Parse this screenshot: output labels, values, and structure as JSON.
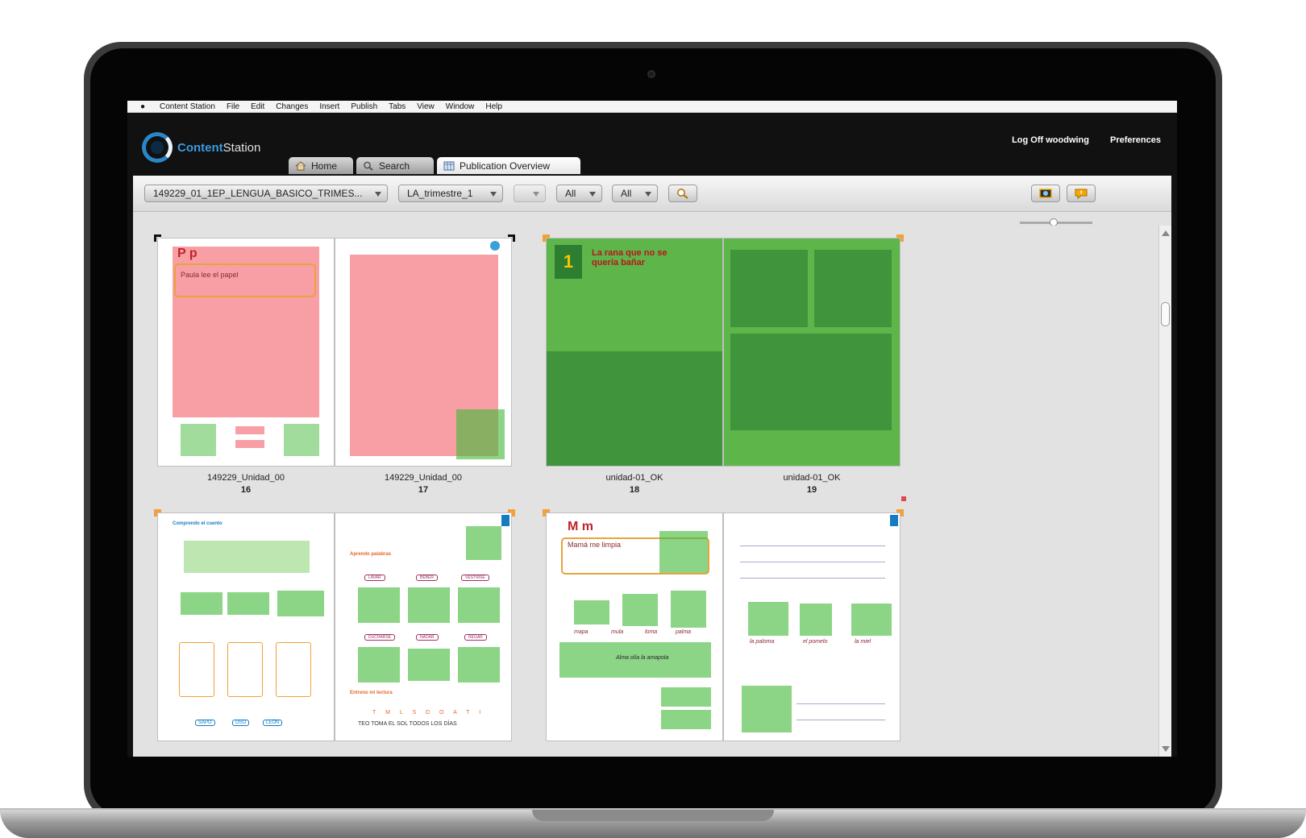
{
  "menubar": {
    "items": [
      "Content Station",
      "File",
      "Edit",
      "Changes",
      "Insert",
      "Publish",
      "Tabs",
      "View",
      "Window",
      "Help"
    ]
  },
  "app": {
    "logo_part1": "Content",
    "logo_part2": "Station",
    "tabs": [
      {
        "label": "Home",
        "icon": "home-icon"
      },
      {
        "label": "Search",
        "icon": "search-icon"
      },
      {
        "label": "Publication Overview",
        "icon": "grid-icon",
        "active": true
      }
    ],
    "logoff": "Log Off woodwing",
    "preferences": "Preferences"
  },
  "toolbar": {
    "publication": "149229_01_1EP_LENGUA_BASICO_TRIMES...",
    "issue": "LA_trimestre_1",
    "edition": "",
    "filter1": "All",
    "filter2": "All"
  },
  "spreads": [
    {
      "left_name": "149229_Unidad_00",
      "left_num": "16",
      "right_name": "149229_Unidad_00",
      "right_num": "17",
      "status": "red"
    },
    {
      "left_name": "unidad-01_OK",
      "left_num": "18",
      "right_name": "unidad-01_OK",
      "right_num": "19",
      "status": "green"
    },
    {
      "left_name": "",
      "left_num": "",
      "right_name": "",
      "right_num": "",
      "status": "white"
    },
    {
      "left_name": "",
      "left_num": "",
      "right_name": "",
      "right_num": "",
      "status": "green"
    }
  ],
  "page_text": {
    "p16_title": "P p",
    "p16_phrase": "Paula lee el papel",
    "p18_title": "La rana que no se quería bañar",
    "p18_num": "1",
    "p20_heading": "Comprendo el cuento",
    "p21_heading1": "Aprendo palabras",
    "p21_heading2": "Entreno mi lectura",
    "p21_words": [
      "LAVAR",
      "BEBER",
      "VESTIRSE",
      "DUCHARSE",
      "NADAR",
      "REGAR"
    ],
    "p21_letters": "T M L S D O A T I",
    "p21_sentence": "TEO TOMA EL SOL TODOS LOS DÍAS",
    "p20_answers": [
      "SAPO",
      "OSO",
      "LEÓN"
    ],
    "p22_title": "M m",
    "p22_phrase": "Mamá me limpia",
    "p22_words": [
      "mapa",
      "mula",
      "loma",
      "palma"
    ],
    "p22_sentence": "Alma olía la amapola",
    "p23_words": [
      "la paloma",
      "el pomelo",
      "la miel"
    ]
  },
  "colors": {
    "accent_blue": "#2a86c9",
    "status_red": "#f0505a",
    "status_green": "#46b93c"
  }
}
